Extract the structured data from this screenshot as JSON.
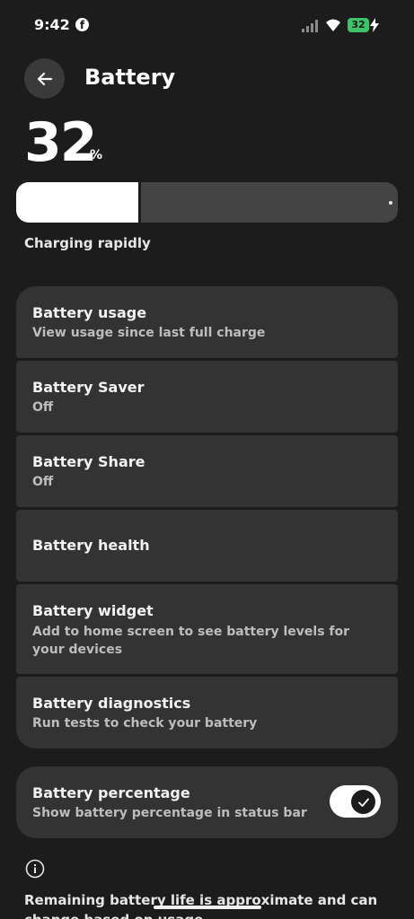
{
  "status_bar": {
    "time": "9:42",
    "facebook_glyph": "f",
    "battery_level": "32",
    "icons": [
      "facebook-icon",
      "signal-icon",
      "wifi-icon",
      "battery-charging-icon"
    ],
    "battery_color": "#3ec36b"
  },
  "header": {
    "title": "Battery",
    "back_icon": "arrow-left-icon"
  },
  "battery": {
    "percent": "32",
    "percent_sign": "%",
    "level_fraction": 0.32,
    "status": "Charging rapidly"
  },
  "menu": {
    "items": [
      {
        "title": "Battery usage",
        "subtitle": "View usage since last full charge"
      },
      {
        "title": "Battery Saver",
        "subtitle": "Off"
      },
      {
        "title": "Battery Share",
        "subtitle": "Off"
      },
      {
        "title": "Battery health",
        "subtitle": ""
      },
      {
        "title": "Battery widget",
        "subtitle": "Add to home screen to see battery levels for your devices"
      },
      {
        "title": "Battery diagnostics",
        "subtitle": "Run tests to check your battery"
      }
    ]
  },
  "percentage_toggle": {
    "title": "Battery percentage",
    "subtitle": "Show battery percentage in status bar",
    "enabled": true
  },
  "footer": {
    "info_icon": "info-icon",
    "text": "Remaining battery life is approximate and can change based on usage"
  }
}
